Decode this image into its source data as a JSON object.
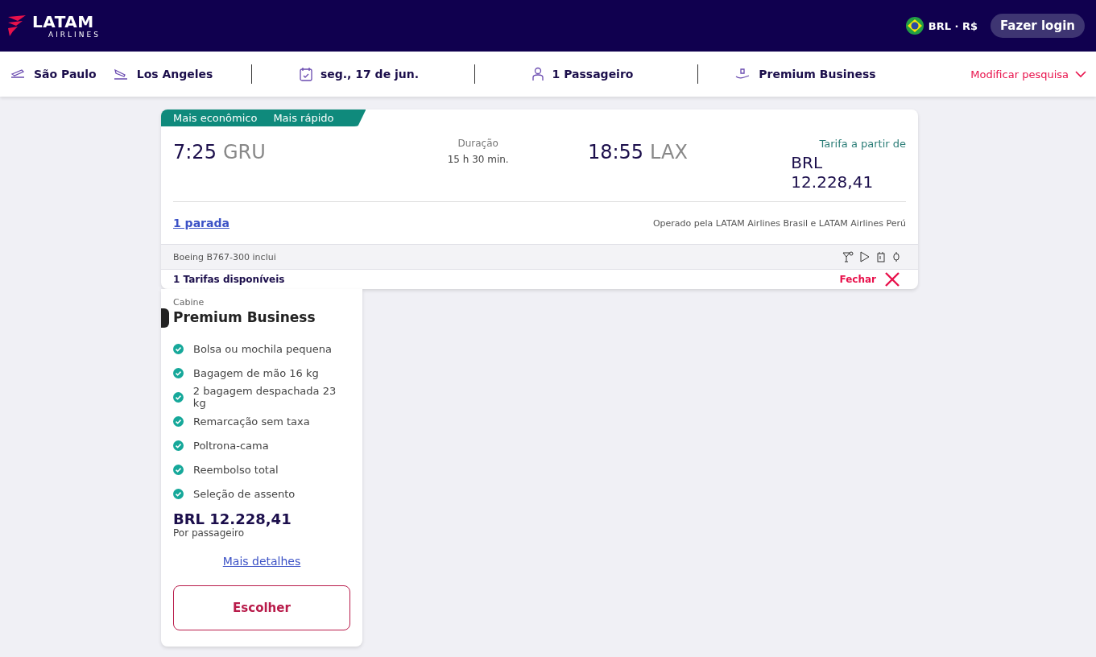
{
  "header": {
    "logo": {
      "name": "LATAM",
      "sub": "AIRLINES"
    },
    "currency": "BRL · R$",
    "login": "Fazer login"
  },
  "search": {
    "origin": "São Paulo",
    "destination": "Los Angeles",
    "date": "seg., 17 de jun.",
    "passengers": "1 Passageiro",
    "cabin": "Premium Business",
    "modify": "Modificar pesquisa"
  },
  "flight": {
    "tags": [
      "Mais econômico",
      "Mais rápido"
    ],
    "departure_time": "7:25",
    "departure_airport": "GRU",
    "duration_label": "Duração",
    "duration": "15 h 30 min.",
    "arrival_time": "18:55",
    "arrival_airport": "LAX",
    "price_label": "Tarifa a partir de",
    "price": "BRL 12.228,41",
    "stops": "1 parada",
    "operator": "Operado pela LATAM Airlines Brasil e LATAM Airlines Perú",
    "aircraft": "Boeing B767-300 inclui",
    "fares_count": "1 Tarifas disponíveis",
    "close": "Fechar"
  },
  "fare": {
    "cabin_label": "Cabine",
    "cabin": "Premium Business",
    "features": [
      "Bolsa ou mochila pequena",
      "Bagagem de mão 16 kg",
      "2 bagagem despachada 23 kg",
      "Remarcação sem taxa",
      "Poltrona-cama",
      "Reembolso total",
      "Seleção de assento"
    ],
    "price": "BRL 12.228,41",
    "price_note": "Por passageiro",
    "details": "Mais detalhes",
    "choose": "Escolher"
  }
}
